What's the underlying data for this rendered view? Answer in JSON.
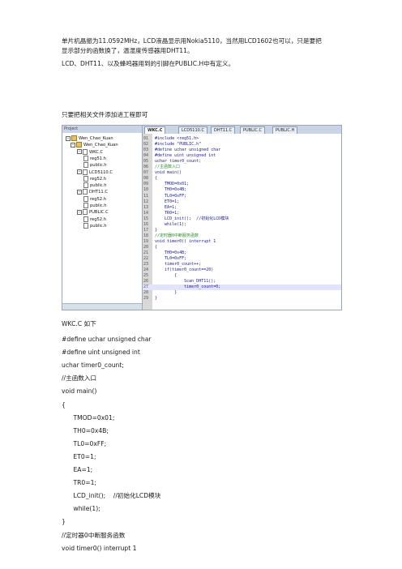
{
  "intro": {
    "line1": "单片机晶振为11.0592MHz，LCD液晶显示用Nokia5110，当然用LCD1602也可以，只是要把",
    "line2": "显示部分的函数换了，温湿度传感器用DHT11。",
    "line3": "LCD、DHT11、以及蜂鸣器用到的引脚在PUBLIC.H中有定义。",
    "line4": "只要把相关文件添加进工程即可"
  },
  "ide": {
    "project_title": "Project",
    "tree": [
      {
        "label": "Wen_Chao_Kuan",
        "kind": "root"
      },
      {
        "label": "Wen_Chao_Kuan",
        "kind": "group"
      },
      {
        "label": "WKC.C",
        "kind": "file"
      },
      {
        "label": "reg51.h",
        "kind": "inc"
      },
      {
        "label": "public.h",
        "kind": "inc"
      },
      {
        "label": "LCD5110.C",
        "kind": "file"
      },
      {
        "label": "reg52.h",
        "kind": "inc"
      },
      {
        "label": "public.h",
        "kind": "inc"
      },
      {
        "label": "DHT11.C",
        "kind": "file"
      },
      {
        "label": "reg52.h",
        "kind": "inc"
      },
      {
        "label": "public.h",
        "kind": "inc"
      },
      {
        "label": "PUBLIC.C",
        "kind": "file"
      },
      {
        "label": "reg52.h",
        "kind": "inc"
      },
      {
        "label": "public.h",
        "kind": "inc"
      }
    ],
    "tabs": [
      "WKC.C",
      "LCD5110.C",
      "DHT11.C",
      "PUBLIC.C",
      "PUBLIC.H"
    ],
    "code": [
      {
        "n": "01",
        "t": "#include <reg51.h>"
      },
      {
        "n": "02",
        "t": "#include \"PUBLIC.h\""
      },
      {
        "n": "03",
        "t": "#define uchar unsigned char"
      },
      {
        "n": "04",
        "t": "#define uint unsigned int"
      },
      {
        "n": "05",
        "t": "uchar timer0_count;"
      },
      {
        "n": "06",
        "t": "//主函数入口"
      },
      {
        "n": "07",
        "t": "void main()"
      },
      {
        "n": "08",
        "t": "{"
      },
      {
        "n": "09",
        "t": "    TMOD=0x01;"
      },
      {
        "n": "10",
        "t": "    TH0=0x4B;"
      },
      {
        "n": "11",
        "t": "    TL0=0xFF;"
      },
      {
        "n": "12",
        "t": "    ET0=1;"
      },
      {
        "n": "13",
        "t": "    EA=1;"
      },
      {
        "n": "14",
        "t": "    TR0=1;"
      },
      {
        "n": "15",
        "t": "    LCD_init();  //初始化LCD模块"
      },
      {
        "n": "16",
        "t": "    while(1);"
      },
      {
        "n": "17",
        "t": "}"
      },
      {
        "n": "18",
        "t": "//定时器0中断服务函数"
      },
      {
        "n": "19",
        "t": "void timer0() interrupt 1"
      },
      {
        "n": "20",
        "t": "{"
      },
      {
        "n": "21",
        "t": "    TH0=0x4B;"
      },
      {
        "n": "22",
        "t": "    TL0=0xFF;"
      },
      {
        "n": "23",
        "t": "    timer0_count++;"
      },
      {
        "n": "24",
        "t": "    if(timer0_count==20)"
      },
      {
        "n": "25",
        "t": "        {"
      },
      {
        "n": "26",
        "t": "            Scan_DHT11();"
      },
      {
        "n": "27",
        "t": "            timer0_count=0;"
      },
      {
        "n": "28",
        "t": "        }"
      },
      {
        "n": "29",
        "t": "}"
      }
    ]
  },
  "listing": {
    "heading": "WKC.C 如下",
    "lines": [
      "#define uchar unsigned char",
      "#define uint unsigned int",
      "uchar timer0_count;",
      "//主函数入口",
      "void main()",
      "{",
      "      TMOD=0x01;",
      "      TH0=0x4B;",
      "      TL0=0xFF;",
      "      ET0=1;",
      "      EA=1;",
      "      TR0=1;",
      "      LCD_init();    //初始化LCD模块",
      "      while(1);",
      "}",
      "//定时器0中断服务函数",
      "void timer0() interrupt 1"
    ]
  }
}
